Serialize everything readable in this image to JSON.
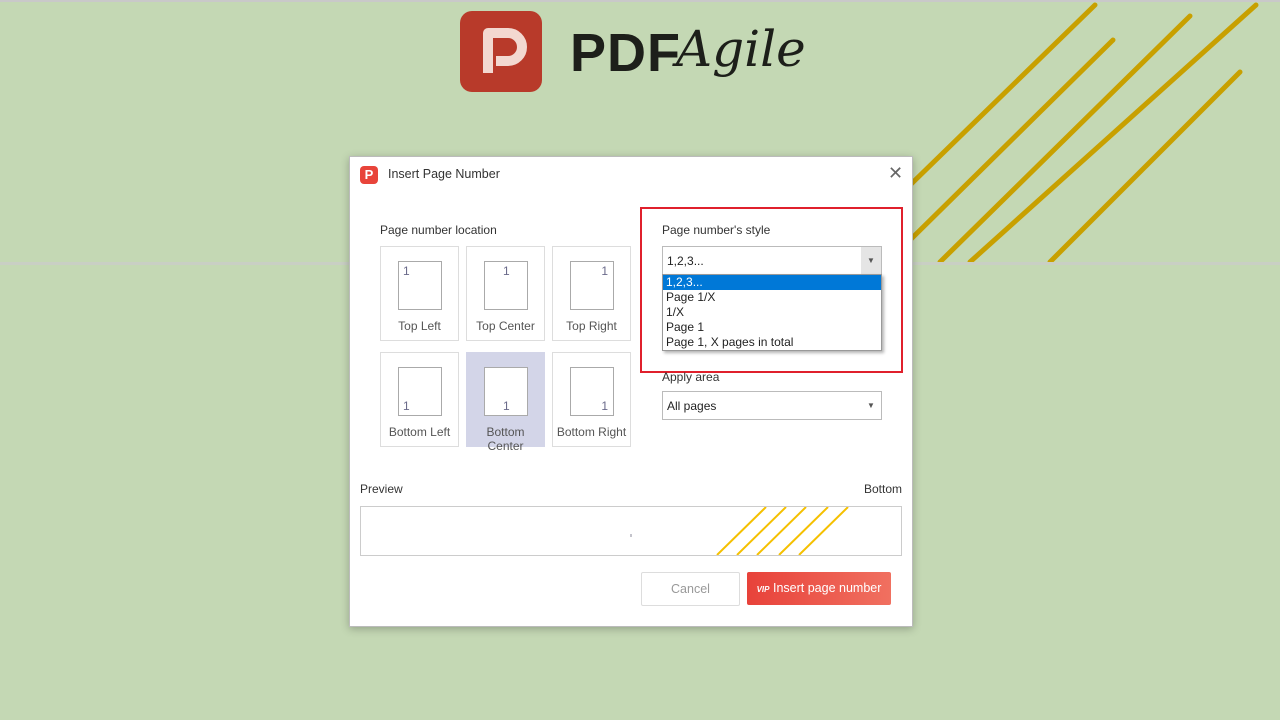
{
  "brand": {
    "name_bold": "PDF",
    "name_script": "Agile",
    "accent": "#e8443a",
    "stripe_color": "#c8a000"
  },
  "dialog": {
    "title": "Insert Page Number",
    "close_icon": "close-icon",
    "location": {
      "label": "Page number location",
      "selected": "Bottom Center",
      "options": [
        {
          "label": "Top Left",
          "num": "1"
        },
        {
          "label": "Top Center",
          "num": "1"
        },
        {
          "label": "Top Right",
          "num": "1"
        },
        {
          "label": "Bottom Left",
          "num": "1"
        },
        {
          "label": "Bottom Center",
          "num": "1"
        },
        {
          "label": "Bottom Right",
          "num": "1"
        }
      ]
    },
    "style": {
      "label": "Page number's style",
      "value": "1,2,3...",
      "options": [
        "1,2,3...",
        "Page 1/X",
        "1/X",
        "Page 1",
        "Page 1, X pages in total"
      ],
      "highlighted": "1,2,3..."
    },
    "apply_area": {
      "label": "Apply area",
      "value": "All pages"
    },
    "preview": {
      "label": "Preview",
      "position": "Bottom"
    },
    "buttons": {
      "cancel": "Cancel",
      "insert": "Insert page number",
      "vip_badge": "VIP"
    }
  }
}
